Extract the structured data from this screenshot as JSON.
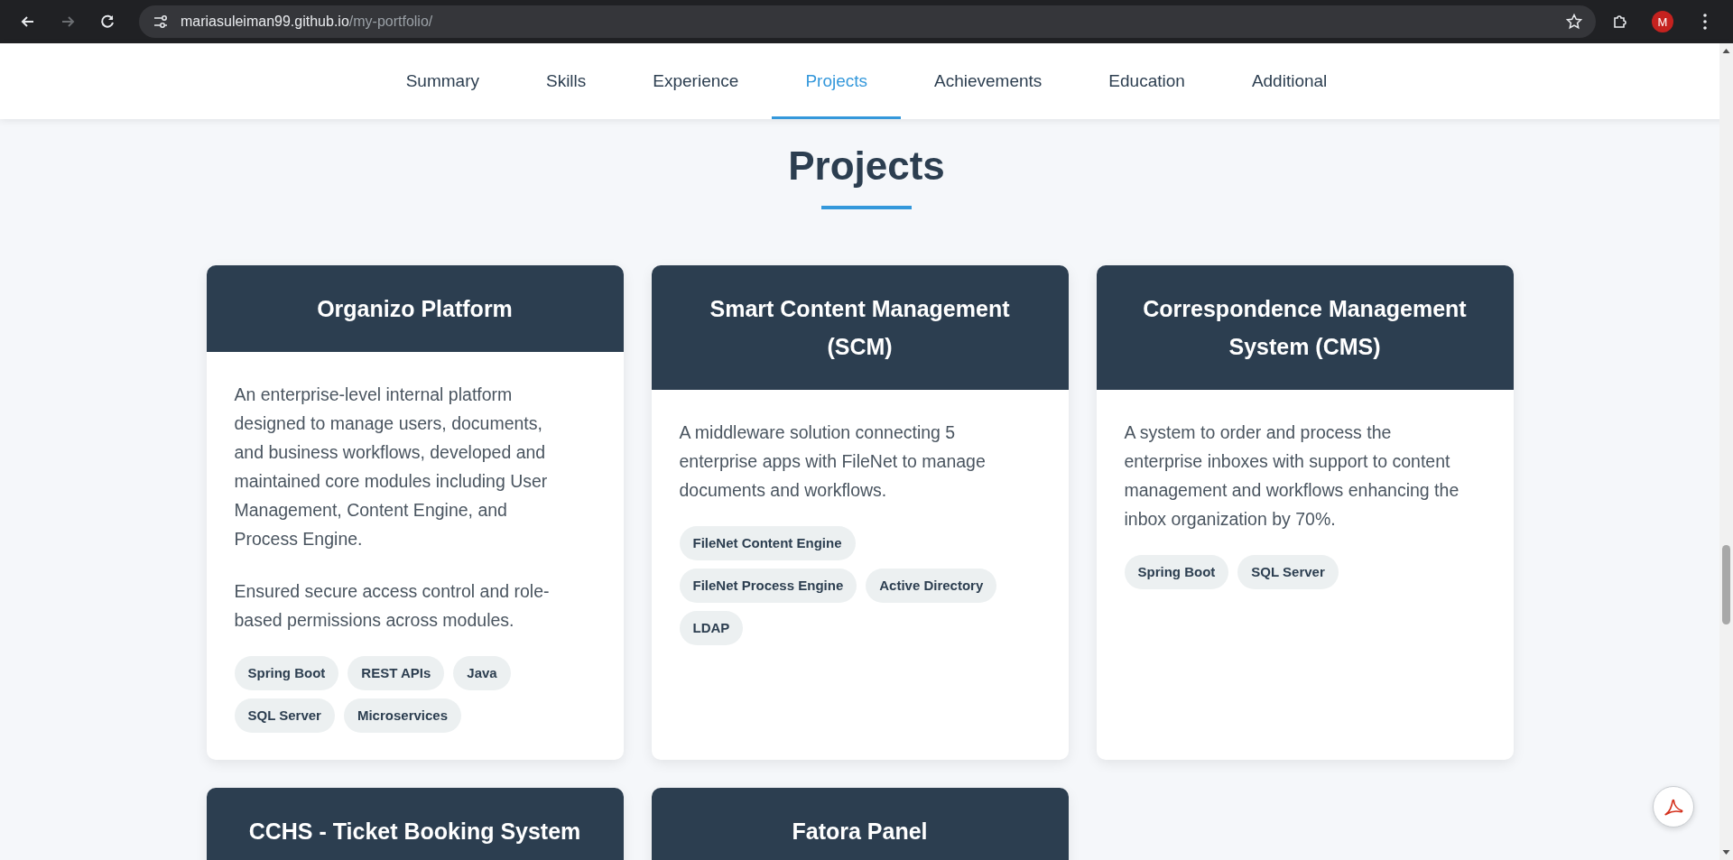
{
  "browser": {
    "url_domain": "mariasuleiman99.github.io",
    "url_path": "/my-portfolio/",
    "profile_initial": "M"
  },
  "nav": {
    "tabs": [
      {
        "label": "Summary",
        "selected": false
      },
      {
        "label": "Skills",
        "selected": false
      },
      {
        "label": "Experience",
        "selected": false
      },
      {
        "label": "Projects",
        "selected": true
      },
      {
        "label": "Achievements",
        "selected": false
      },
      {
        "label": "Education",
        "selected": false
      },
      {
        "label": "Additional",
        "selected": false
      }
    ]
  },
  "section": {
    "title": "Projects"
  },
  "projects": [
    {
      "title": "Organizo Platform",
      "paragraphs": [
        "An enterprise-level internal platform designed to manage users, documents, and business workflows, developed and maintained core modules including User Management, Content Engine, and Process Engine.",
        "Ensured secure access control and role-based permissions across modules."
      ],
      "tags": [
        "Spring Boot",
        "REST APIs",
        "Java",
        "SQL Server",
        "Microservices"
      ]
    },
    {
      "title": "Smart Content Management (SCM)",
      "paragraphs": [
        "A middleware solution connecting 5 enterprise apps with FileNet to manage documents and workflows."
      ],
      "tags": [
        "FileNet Content Engine",
        "FileNet Process Engine",
        "Active Directory",
        "LDAP"
      ]
    },
    {
      "title": "Correspondence Management System (CMS)",
      "paragraphs": [
        "A system to order and process the enterprise inboxes with support to content management and workflows enhancing the inbox organization by 70%."
      ],
      "tags": [
        "Spring Boot",
        "SQL Server"
      ]
    },
    {
      "title": "CCHS - Ticket Booking System"
    },
    {
      "title": "Fatora Panel"
    }
  ]
}
